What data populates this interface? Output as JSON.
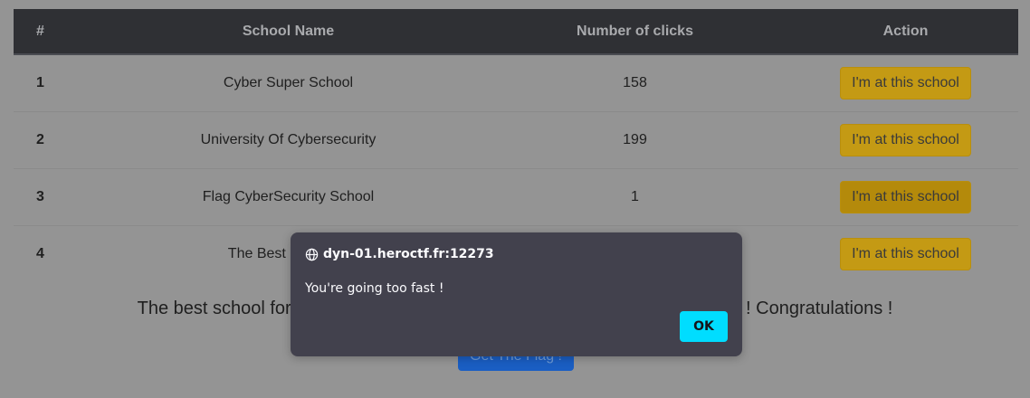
{
  "table": {
    "headers": [
      "#",
      "School Name",
      "Number of clicks",
      "Action"
    ],
    "rows": [
      {
        "num": "1",
        "name": "Cyber Super School",
        "clicks": "158",
        "action": "I'm at this school"
      },
      {
        "num": "2",
        "name": "University Of Cybersecurity",
        "clicks": "199",
        "action": "I'm at this school"
      },
      {
        "num": "3",
        "name": "Flag CyberSecurity School",
        "clicks": "1",
        "action": "I'm at this school"
      },
      {
        "num": "4",
        "name": "The Best Best Cyb",
        "clicks": "",
        "action": "I'm at this school"
      }
    ]
  },
  "congrats_text": "The best school for cybers                                                                  7 clicks ! Congratulations !",
  "flag_button": "Get The Flag !",
  "dialog": {
    "origin": "dyn-01.heroctf.fr:12273",
    "message": "You're going too fast !",
    "ok": "OK"
  }
}
